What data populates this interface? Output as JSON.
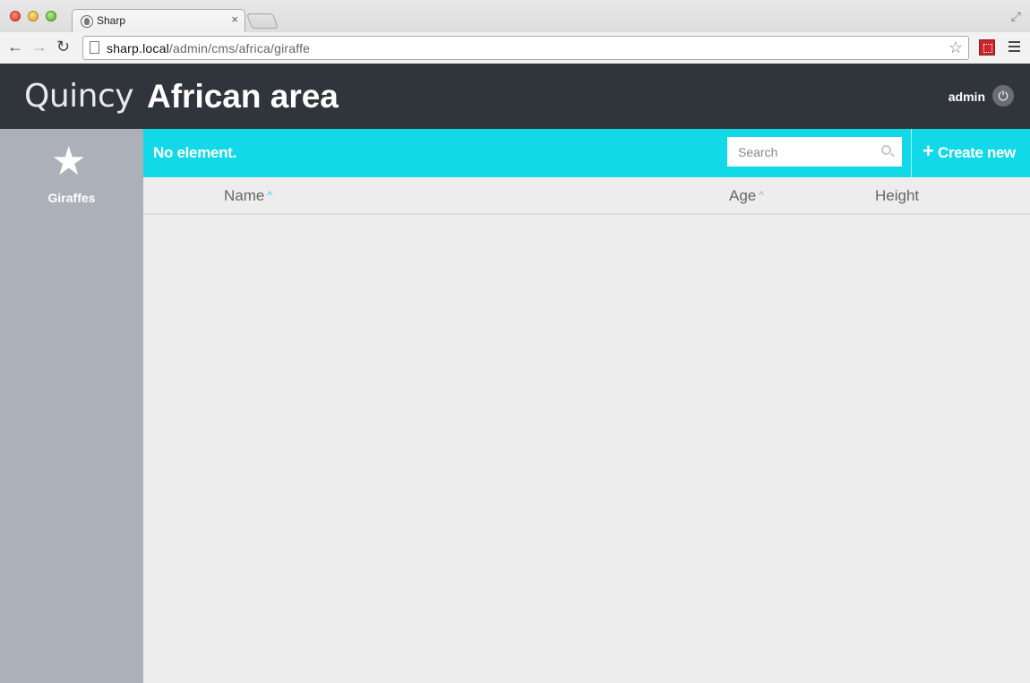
{
  "browser": {
    "tab_title": "Sharp",
    "tab_close": "×",
    "url_host": "sharp.local",
    "url_path": "/admin/cms/africa/giraffe"
  },
  "header": {
    "brand": "Quincy",
    "title": "African area",
    "user": "admin"
  },
  "sidebar": {
    "items": [
      {
        "label": "Giraffes",
        "icon": "star-icon"
      }
    ]
  },
  "listbar": {
    "empty_message": "No element.",
    "search_placeholder": "Search",
    "search_value": "",
    "create_label": "Create new",
    "create_icon": "plus-icon"
  },
  "table": {
    "columns": [
      {
        "label": "Name",
        "sortable": true,
        "sort_active": true
      },
      {
        "label": "Age",
        "sortable": true,
        "sort_active": false
      },
      {
        "label": "Height",
        "sortable": false
      }
    ],
    "rows": []
  },
  "colors": {
    "accent": "#12d9e7",
    "header_bg": "#30353c",
    "sidebar_bg": "#acb0b8",
    "content_bg": "#ededed"
  }
}
